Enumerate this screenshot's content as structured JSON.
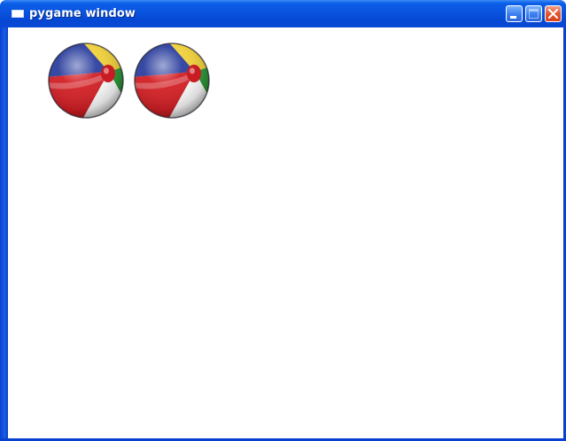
{
  "window": {
    "title": "pygame window",
    "controls": [
      "minimize",
      "maximize",
      "close"
    ]
  },
  "canvas": {
    "background": "#ffffff",
    "sprites": [
      {
        "name": "beach-ball",
        "colors": [
          "#2c3f9e",
          "#d31f24",
          "#f2d23a",
          "#2f9a3a",
          "#ffffff"
        ]
      },
      {
        "name": "beach-ball",
        "colors": [
          "#2c3f9e",
          "#d31f24",
          "#f2d23a",
          "#2f9a3a",
          "#ffffff"
        ]
      }
    ]
  },
  "colors": {
    "titlebar": "#0a55df",
    "close_button": "#e2552f"
  }
}
